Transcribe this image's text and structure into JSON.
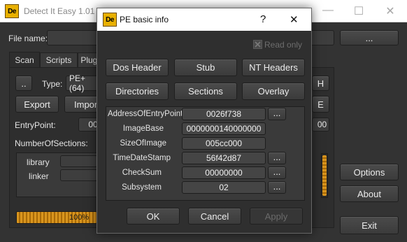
{
  "main": {
    "title": "Detect It Easy 1.01",
    "logo_text": "De",
    "controls": {
      "minimize": "—",
      "maximize": "☐",
      "close": "✕"
    },
    "file_name_label": "File name:",
    "browse_button": "...",
    "tabs": [
      {
        "label": "Scan"
      },
      {
        "label": "Scripts"
      },
      {
        "label": "Plugins"
      }
    ],
    "left_dots_button": "..",
    "type_label": "Type:",
    "type_value": "PE+(64)",
    "export_button": "Export",
    "import_button": "Import",
    "entrypoint_label": "EntryPoint:",
    "entrypoint_value_partial": "00",
    "number_of_sections_label": "NumberOfSections:",
    "list_items": [
      "library",
      "linker"
    ],
    "progress": {
      "percent": 100,
      "text": "100%"
    },
    "right_h_button": "H",
    "right_e_button": "E",
    "right_field_partial": "00",
    "options_button": "Options",
    "about_button": "About",
    "exit_button": "Exit"
  },
  "dialog": {
    "title": "PE basic info",
    "logo_text": "De",
    "help": "?",
    "close": "✕",
    "read_only_label": "Read only",
    "read_only_checked": true,
    "buttons_row1": [
      "Dos Header",
      "Stub",
      "NT Headers"
    ],
    "buttons_row2": [
      "Directories",
      "Sections",
      "Overlay"
    ],
    "fields": [
      {
        "label": "AddressOfEntryPoint",
        "value": "0026f738",
        "has_more": true
      },
      {
        "label": "ImageBase",
        "value": "0000000140000000",
        "has_more": false
      },
      {
        "label": "SizeOfImage",
        "value": "005cc000",
        "has_more": false
      },
      {
        "label": "TimeDateStamp",
        "value": "56f42d87",
        "has_more": true
      },
      {
        "label": "CheckSum",
        "value": "00000000",
        "has_more": true
      },
      {
        "label": "Subsystem",
        "value": "02",
        "has_more": true
      }
    ],
    "more_button": "...",
    "ok_button": "OK",
    "cancel_button": "Cancel",
    "apply_button": "Apply"
  }
}
